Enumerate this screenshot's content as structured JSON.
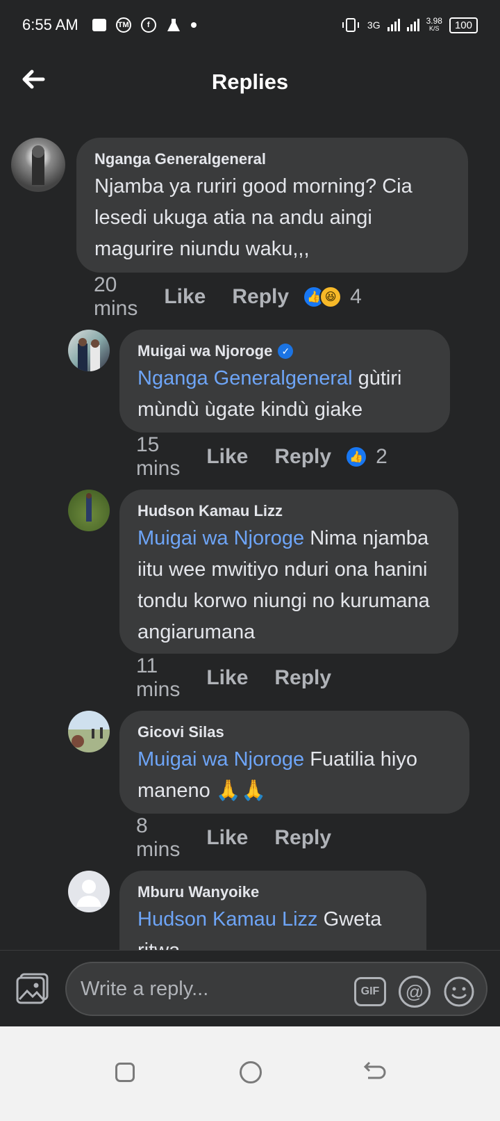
{
  "status_bar": {
    "time": "6:55 AM",
    "network": "3G",
    "speed_value": "3.98",
    "speed_unit": "K/S",
    "battery": "100"
  },
  "header": {
    "title": "Replies",
    "back_icon": "arrow-left-icon"
  },
  "comments": [
    {
      "author": "Nganga Generalgeneral",
      "verified": false,
      "mention": "",
      "text": "Njamba ya ruriri good morning? Cia lesedi ukuga atia na andu aingi magurire niundu waku,,,",
      "time": "20 mins",
      "like_label": "Like",
      "reply_label": "Reply",
      "reactions": [
        "like",
        "haha"
      ],
      "reaction_count": "4"
    },
    {
      "author": "Muigai wa Njoroge",
      "verified": true,
      "mention": "Nganga Generalgeneral",
      "text": " gùtiri mùndù ùgate kindù giake",
      "time": "15 mins",
      "like_label": "Like",
      "reply_label": "Reply",
      "reactions": [
        "like"
      ],
      "reaction_count": "2"
    },
    {
      "author": "Hudson Kamau Lizz",
      "verified": false,
      "mention": "Muigai wa Njoroge",
      "text": " Nima njamba iitu wee mwitiyo nduri ona hanini tondu korwo niungi no kurumana angiarumana",
      "time": "11 mins",
      "like_label": "Like",
      "reply_label": "Reply",
      "reactions": [],
      "reaction_count": ""
    },
    {
      "author": "Gicovi Silas",
      "verified": false,
      "mention": "Muigai wa Njoroge",
      "text": " Fuatilia hiyo maneno 🙏🙏",
      "time": "8 mins",
      "like_label": "Like",
      "reply_label": "Reply",
      "reactions": [],
      "reaction_count": ""
    },
    {
      "author": "Mburu Wanyoike",
      "verified": false,
      "mention": "Hudson Kamau Lizz",
      "text": " Gweta ritwa",
      "time": "",
      "like_label": "",
      "reply_label": "",
      "reactions": [],
      "reaction_count": ""
    }
  ],
  "composer": {
    "placeholder": "Write a reply...",
    "gif_label": "GIF",
    "at_label": "@"
  },
  "colors": {
    "background": "#242526",
    "bubble": "#3a3b3c",
    "mention": "#6ea5f7",
    "muted": "#b0b3b8",
    "like_blue": "#1877f2"
  }
}
